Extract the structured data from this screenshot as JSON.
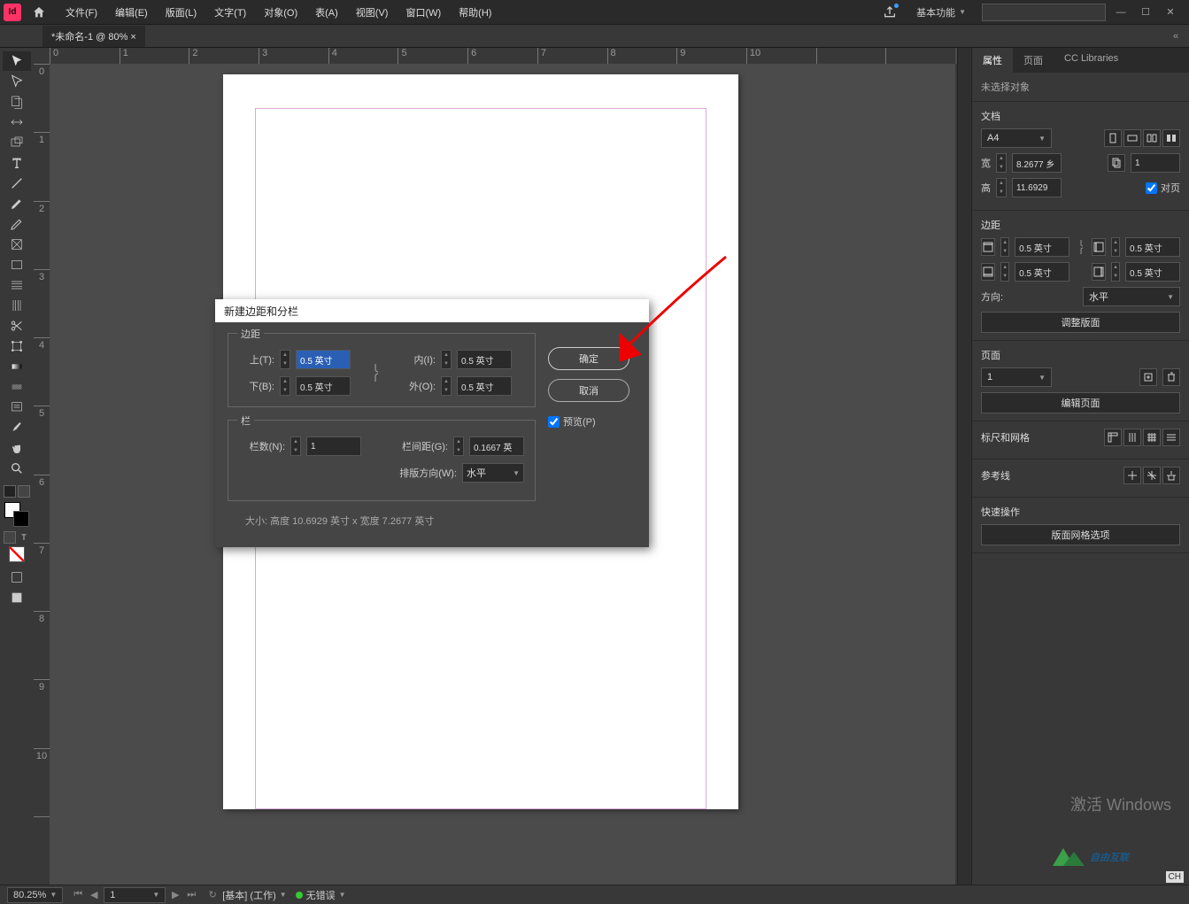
{
  "menu": {
    "items": [
      "文件(F)",
      "编辑(E)",
      "版面(L)",
      "文字(T)",
      "对象(O)",
      "表(A)",
      "视图(V)",
      "窗口(W)",
      "帮助(H)"
    ],
    "workspace": "基本功能"
  },
  "tabs": {
    "document": "*未命名-1 @ 80% ×"
  },
  "rulerH": [
    "0",
    "1",
    "2",
    "3",
    "4",
    "5",
    "6",
    "7",
    "8",
    "9",
    "10"
  ],
  "rulerV": [
    "0",
    "1",
    "2",
    "3",
    "4",
    "5",
    "6",
    "7",
    "8",
    "9",
    "10"
  ],
  "dialog": {
    "title": "新建边距和分栏",
    "margins": {
      "legend": "边距",
      "top_label": "上(T):",
      "top": "0.5 英寸",
      "bottom_label": "下(B):",
      "bottom": "0.5 英寸",
      "inside_label": "内(I):",
      "inside": "0.5 英寸",
      "outside_label": "外(O):",
      "outside": "0.5 英寸"
    },
    "columns": {
      "legend": "栏",
      "num_label": "栏数(N):",
      "num": "1",
      "gutter_label": "栏间距(G):",
      "gutter": "0.1667 英",
      "dir_label": "排版方向(W):",
      "dir": "水平"
    },
    "ok": "确定",
    "cancel": "取消",
    "preview": "预览(P)",
    "size": "大小:  高度 10.6929 英寸 x 宽度 7.2677 英寸"
  },
  "panel": {
    "tabs": {
      "props": "属性",
      "pages": "页面",
      "cclib": "CC Libraries"
    },
    "nosel": "未选择对象",
    "doc": {
      "title": "文档",
      "preset": "A4",
      "w_label": "宽",
      "w": "8.2677 乡",
      "h_label": "高",
      "h": "11.6929",
      "pages": "1",
      "facing": "对页"
    },
    "margins": {
      "title": "边距",
      "t": "0.5 英寸",
      "b": "0.5 英寸",
      "i": "0.5 英寸",
      "o": "0.5 英寸",
      "dir_label": "方向:",
      "dir": "水平",
      "adjust": "调整版面"
    },
    "page": {
      "title": "页面",
      "num": "1",
      "edit": "编辑页面"
    },
    "rulers": {
      "title": "标尺和网格"
    },
    "guides": {
      "title": "参考线"
    },
    "quick": {
      "title": "快速操作",
      "opt": "版面网格选项"
    }
  },
  "status": {
    "zoom": "80.25%",
    "page": "1",
    "style": "[基本] (工作)",
    "err": "无错误"
  },
  "watermark": {
    "l1": "激活 Windows",
    "brand": "自由互联",
    "ch": "CH"
  }
}
